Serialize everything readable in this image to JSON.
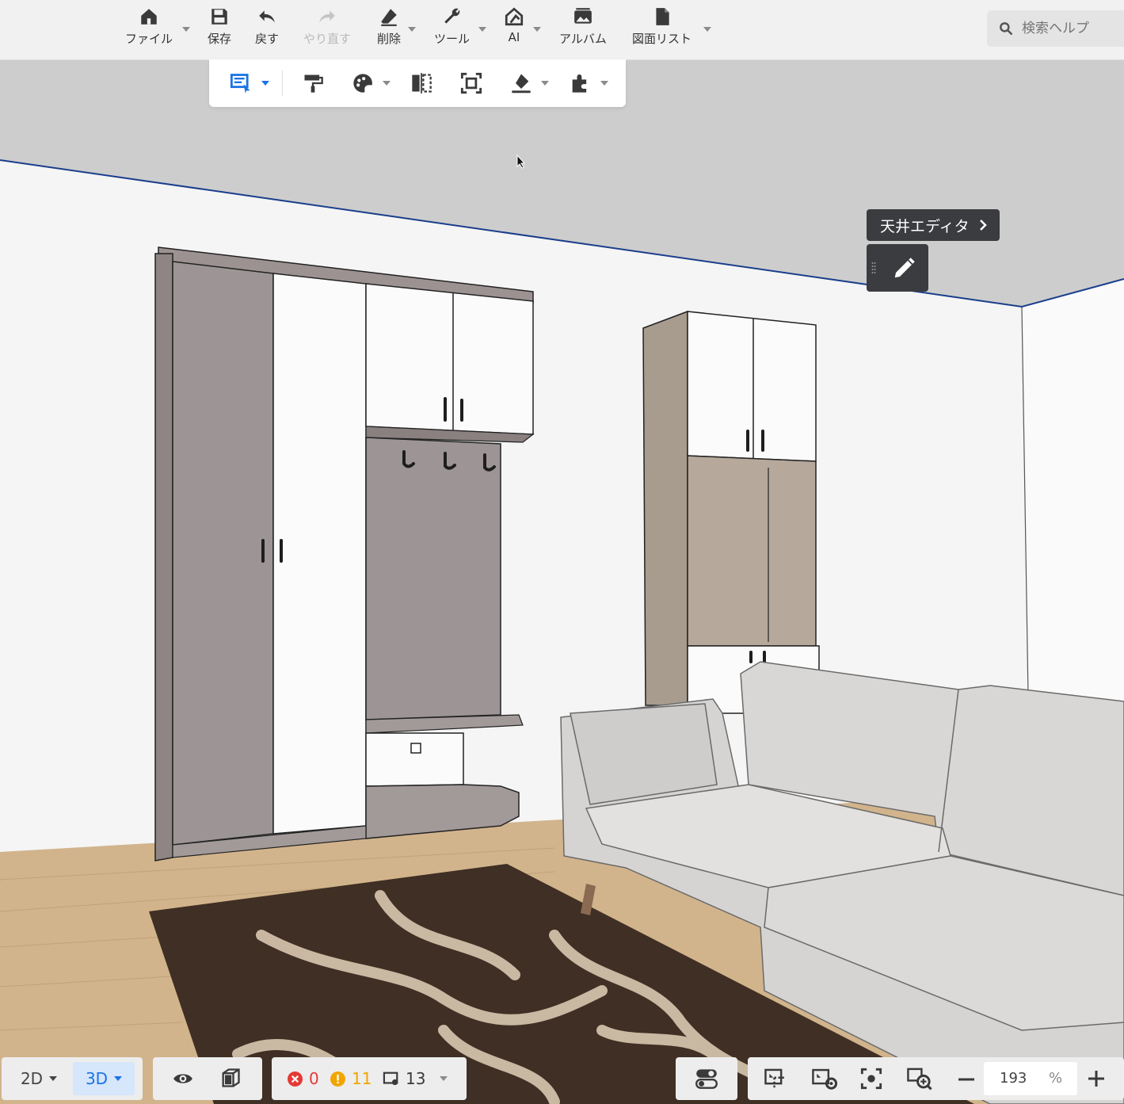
{
  "toolbar": {
    "file_label": "ファイル",
    "save_label": "保存",
    "undo_label": "戻す",
    "redo_label": "やり直す",
    "delete_label": "削除",
    "tools_label": "ツール",
    "ai_label": "AI",
    "album_label": "アルバム",
    "drawing_list_label": "図面リスト"
  },
  "search": {
    "placeholder": "検索ヘルプ"
  },
  "ceiling_editor": {
    "label": "天井エディタ"
  },
  "view_mode": {
    "label_2d": "2D",
    "label_3d": "3D",
    "active": "3D"
  },
  "status": {
    "errors": "0",
    "warnings": "11",
    "items": "13"
  },
  "zoom": {
    "value": "193",
    "unit": "%"
  },
  "colors": {
    "accent": "#1a73e8",
    "error": "#e53935",
    "warning": "#f0a500",
    "ceiling_line": "#1a3e8c"
  },
  "icons": [
    "home-icon",
    "save-icon",
    "undo-icon",
    "redo-icon",
    "eraser-icon",
    "wrench-icon",
    "ai-house-icon",
    "album-icon",
    "document-icon",
    "search-icon",
    "select-icon",
    "paint-roller-icon",
    "material-picker-icon",
    "mirror-icon",
    "frame-icon",
    "level-tool-icon",
    "plugin-icon",
    "pencil-icon",
    "eye-icon",
    "cube-icon",
    "error-icon",
    "warning-icon",
    "layers-icon",
    "toggle-icon",
    "fit-view-icon",
    "view-settings-icon",
    "focus-icon",
    "zoom-window-icon",
    "zoom-out-icon",
    "zoom-in-icon"
  ]
}
